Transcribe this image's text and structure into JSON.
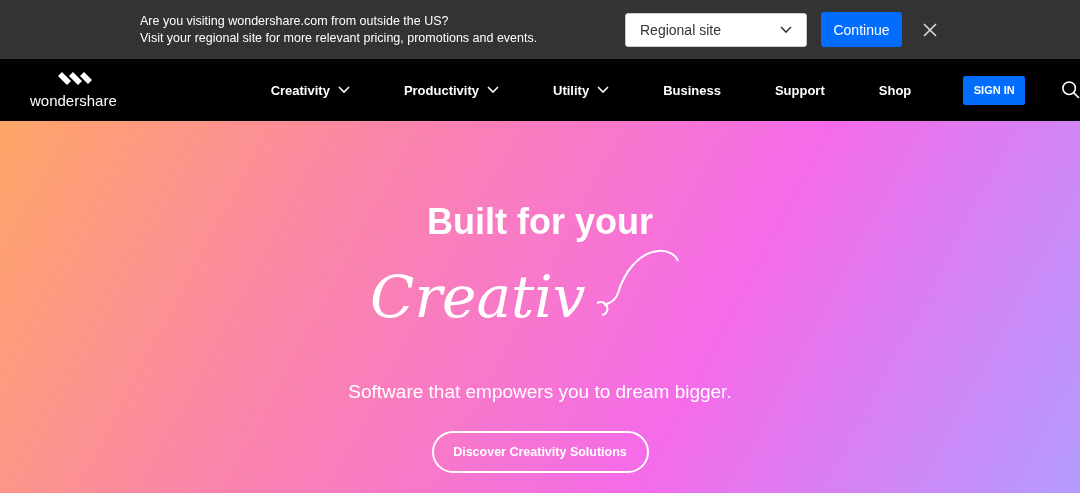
{
  "region_banner": {
    "lines": [
      "Are you visiting wondershare.com from outside the US?",
      "Visit your regional site for more relevant pricing, promotions and events."
    ],
    "select": {
      "value": "Regional site"
    },
    "button": "Continue"
  },
  "navbar": {
    "logo": "wondershare",
    "items": [
      {
        "label": "Creativity",
        "has_menu": true
      },
      {
        "label": "Productivity",
        "has_menu": true
      },
      {
        "label": "Utility",
        "has_menu": true
      },
      {
        "label": "Business",
        "has_menu": false
      },
      {
        "label": "Support",
        "has_menu": false
      },
      {
        "label": "Shop",
        "has_menu": false
      }
    ],
    "sign_in": "SIGN IN"
  },
  "hero": {
    "title": "Built for your",
    "script": "Creativ",
    "subtitle": "Software that empowers you to dream bigger.",
    "button": "Discover Creativity Solutions"
  }
}
